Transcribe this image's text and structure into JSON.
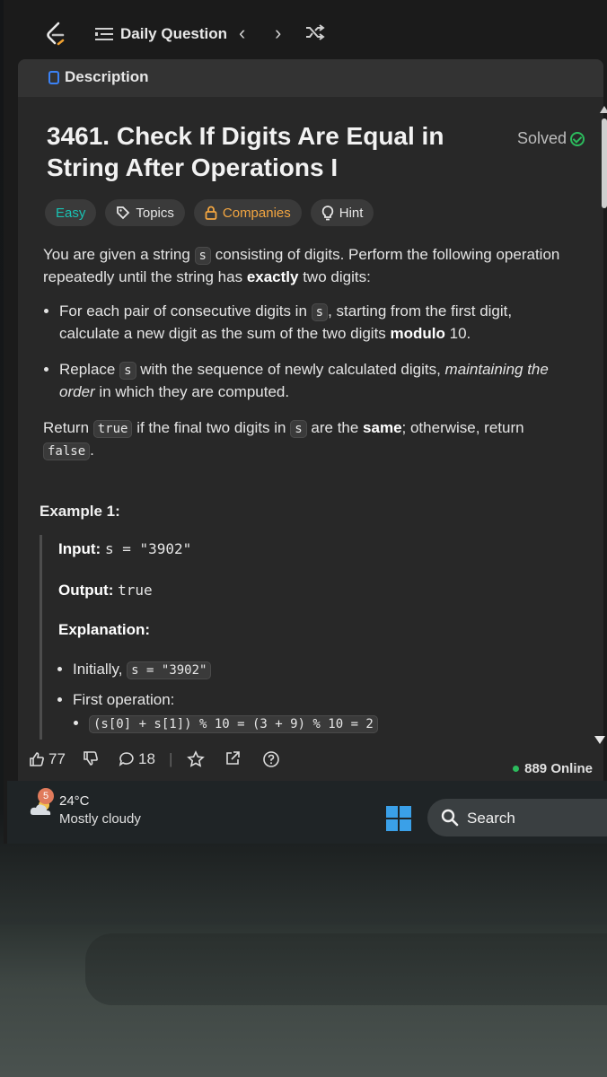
{
  "nav": {
    "daily_label": "Daily Question",
    "prev": "‹",
    "next": "›"
  },
  "tab": {
    "label": "Description"
  },
  "problem": {
    "title": "3461. Check If Digits Are Equal in String After Operations I",
    "status": "Solved",
    "tags": {
      "difficulty": "Easy",
      "topics": "Topics",
      "companies": "Companies",
      "hint": "Hint"
    },
    "intro_1": "You are given a string ",
    "intro_code": "s",
    "intro_2": " consisting of digits. Perform the following operation repeatedly until the string has ",
    "intro_bold": "exactly",
    "intro_3": " two digits:",
    "bullet1_a": "For each pair of consecutive digits in ",
    "bullet1_code": "s",
    "bullet1_b": ", starting from the first digit, calculate a new digit as the sum of the two digits ",
    "bullet1_bold": "modulo",
    "bullet1_c": " 10.",
    "bullet2_a": "Replace ",
    "bullet2_code": "s",
    "bullet2_b": " with the sequence of newly calculated digits, ",
    "bullet2_italic": "maintaining the order",
    "bullet2_c": " in which they are computed.",
    "return_a": "Return ",
    "return_code1": "true",
    "return_b": " if the final two digits in ",
    "return_code2": "s",
    "return_c": " are the ",
    "return_bold": "same",
    "return_d": "; otherwise, return ",
    "return_code3": "false",
    "return_e": "."
  },
  "example": {
    "heading": "Example 1:",
    "input_label": "Input:",
    "input_value": "s = \"3902\"",
    "output_label": "Output:",
    "output_value": "true",
    "explanation_label": "Explanation:",
    "initially_label": "Initially,",
    "initially_code": "s = \"3902\"",
    "first_op_label": "First operation:",
    "first_op_code": "(s[0] + s[1]) % 10 = (3 + 9) % 10 = 2"
  },
  "actions": {
    "likes": "77",
    "comments": "18",
    "online": "889 Online"
  },
  "taskbar": {
    "weather_badge": "5",
    "temperature": "24°C",
    "weather": "Mostly cloudy",
    "search": "Search"
  },
  "colors": {
    "easy": "#19c2b3",
    "companies": "#f3a641",
    "solved": "#2cbb5d",
    "online": "#2cbb5d"
  }
}
